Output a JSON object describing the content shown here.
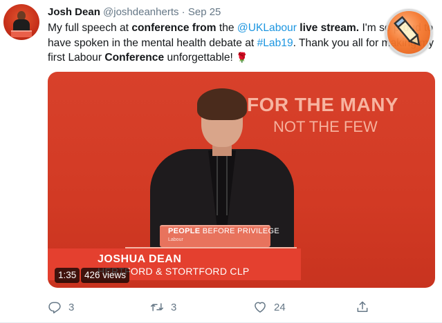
{
  "tweet": {
    "author_name": "Josh Dean",
    "handle": "@joshdeanherts",
    "separator": "·",
    "date": "Sep 25",
    "text": {
      "p1": "My full speech at ",
      "b1": "conference from",
      "p2": " the ",
      "mention": "@UKLabour",
      "p3": " ",
      "b2": "live stream.",
      "p4": " I'm so proud to have spoken in the mental health debate at ",
      "hashtag": "#Lab19",
      "p5": ". Thank you all for making my first Labour ",
      "b3": "Conference",
      "p6": " unforgettable! ",
      "emoji": "🌹"
    }
  },
  "video": {
    "slogan_line1": "FOR THE MANY",
    "slogan_line2": "NOT THE FEW",
    "podium_strong": "PEOPLE",
    "podium_rest": " BEFORE PRIVILEGE",
    "podium_logo": "Labour",
    "lower_third_name": "JOSHUA DEAN",
    "lower_third_sub": "HERTFORD & STORTFORD CLP",
    "duration": "1:35",
    "views": "426 views"
  },
  "actions": {
    "reply_count": "3",
    "retweet_count": "3",
    "like_count": "24"
  },
  "icons": {
    "reply": "reply-icon",
    "retweet": "retweet-icon",
    "like": "heart-icon",
    "share": "share-icon",
    "overlay": "pencil-icon"
  },
  "colors": {
    "link": "#1b95e0",
    "secondary_text": "#657786",
    "labour_red": "#e4402f"
  }
}
